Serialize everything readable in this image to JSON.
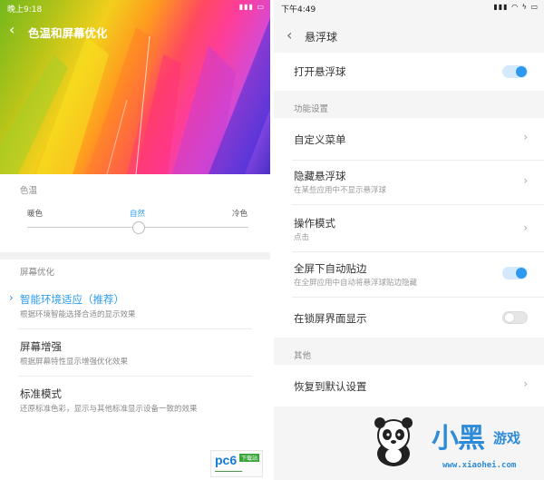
{
  "left": {
    "status": {
      "time": "晚上9:18"
    },
    "header": {
      "title": "色温和屏幕优化"
    },
    "color_temp": {
      "label": "色温",
      "warm": "暖色",
      "natural": "自然",
      "cool": "冷色",
      "slider_value": 0.5
    },
    "screen_opt": {
      "label": "屏幕优化",
      "options": [
        {
          "title": "智能环境适应（推荐）",
          "subtitle": "根据环境智能选择合适的显示效果",
          "selected": true
        },
        {
          "title": "屏幕增强",
          "subtitle": "根据屏幕特性显示增强优化效果",
          "selected": false
        },
        {
          "title": "标准模式",
          "subtitle": "还原标准色彩，显示与其他标准显示设备一致的效果",
          "selected": false
        }
      ]
    },
    "watermark": {
      "logo": "pc6",
      "tag": "下载站"
    }
  },
  "right": {
    "status": {
      "time": "下午4:49"
    },
    "header": {
      "title": "悬浮球"
    },
    "open_ball": {
      "label": "打开悬浮球",
      "on": true
    },
    "function_settings": {
      "label": "功能设置",
      "rows": [
        {
          "title": "自定义菜单",
          "subtitle": ""
        },
        {
          "title": "隐藏悬浮球",
          "subtitle": "在某些应用中不显示悬浮球"
        },
        {
          "title": "操作模式",
          "subtitle": "点击"
        },
        {
          "title": "全屏下自动贴边",
          "subtitle": "在全屏应用中自动将悬浮球贴边隐藏",
          "on": true
        },
        {
          "title": "在锁屏界面显示",
          "subtitle": "",
          "on": false
        }
      ]
    },
    "other": {
      "label": "其他",
      "reset": "恢复到默认设置"
    }
  },
  "watermark": {
    "brand": "小黑",
    "game": "游戏",
    "url": "www.xiaohei.com"
  },
  "colors": {
    "accent": "#2c98ef",
    "selected_text": "#2c9cee"
  }
}
